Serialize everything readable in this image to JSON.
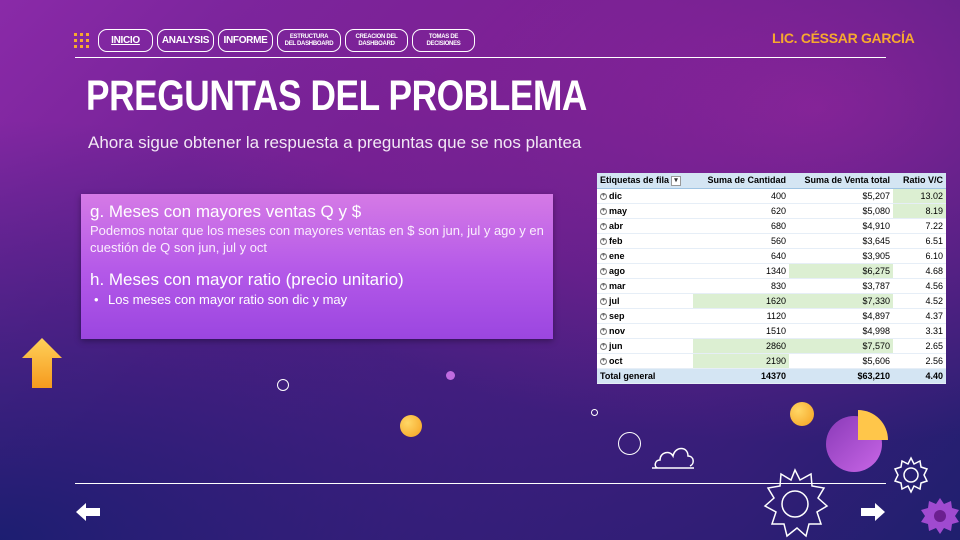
{
  "nav": {
    "items": [
      {
        "label": "INICIO",
        "active": true
      },
      {
        "label": "ANALYSIS"
      },
      {
        "label": "INFORME"
      },
      {
        "label": "ESTRUCTURA DEL DASHBOARD"
      },
      {
        "label": "CREACION DEL DASHBOARD"
      },
      {
        "label": "TOMAS DE DECISIONES"
      }
    ],
    "author": "LIC. CÉSSAR GARCÍA"
  },
  "title": "PREGUNTAS DEL PROBLEMA",
  "subtitle": "Ahora sigue obtener la respuesta a preguntas que se nos plantea",
  "card": {
    "q1_heading": "g. Meses con mayores ventas Q y $",
    "q1_body": "Podemos notar que los meses con mayores ventas en $ son jun, jul y ago y en cuestión de Q son jun, jul y oct",
    "q2_heading": "h. Meses con mayor ratio (precio unitario)",
    "q2_bullet": "Los meses con mayor ratio son dic y may"
  },
  "pivot": {
    "headers": [
      "Etiquetas de fila",
      "Suma de Cantidad",
      "Suma de Venta total",
      "Ratio V/C"
    ],
    "rows": [
      {
        "label": "dic",
        "qty": "400",
        "sales": "$5,207",
        "ratio": "13.02"
      },
      {
        "label": "may",
        "qty": "620",
        "sales": "$5,080",
        "ratio": "8.19"
      },
      {
        "label": "abr",
        "qty": "680",
        "sales": "$4,910",
        "ratio": "7.22"
      },
      {
        "label": "feb",
        "qty": "560",
        "sales": "$3,645",
        "ratio": "6.51"
      },
      {
        "label": "ene",
        "qty": "640",
        "sales": "$3,905",
        "ratio": "6.10"
      },
      {
        "label": "ago",
        "qty": "1340",
        "sales": "$6,275",
        "ratio": "4.68"
      },
      {
        "label": "mar",
        "qty": "830",
        "sales": "$3,787",
        "ratio": "4.56"
      },
      {
        "label": "jul",
        "qty": "1620",
        "sales": "$7,330",
        "ratio": "4.52"
      },
      {
        "label": "sep",
        "qty": "1120",
        "sales": "$4,897",
        "ratio": "4.37"
      },
      {
        "label": "nov",
        "qty": "1510",
        "sales": "$4,998",
        "ratio": "3.31"
      },
      {
        "label": "jun",
        "qty": "2860",
        "sales": "$7,570",
        "ratio": "2.65"
      },
      {
        "label": "oct",
        "qty": "2190",
        "sales": "$5,606",
        "ratio": "2.56"
      }
    ],
    "total": {
      "label": "Total general",
      "qty": "14370",
      "sales": "$63,210",
      "ratio": "4.40"
    },
    "highlight_color": "#dcefd2"
  },
  "icons": {
    "home": "home-up-arrow-icon",
    "prev": "arrow-left-icon",
    "next": "arrow-right-icon",
    "menu": "grid-dots-icon",
    "expand": "expand-circle-icon",
    "filter": "filter-dropdown-icon"
  },
  "colors": {
    "accent": "#f7a92e",
    "card": "#b358e8",
    "header": "#d4e5f3"
  }
}
